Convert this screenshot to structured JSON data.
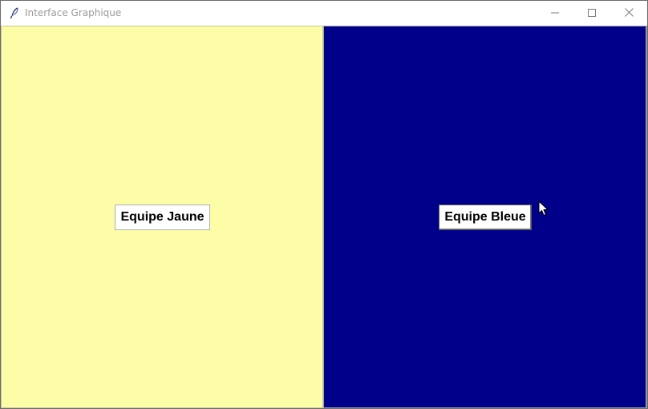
{
  "window": {
    "title": "Interface Graphique",
    "icon": "feather-icon",
    "controls": {
      "minimize": "minimize-icon",
      "maximize": "maximize-icon",
      "close": "close-icon"
    }
  },
  "panels": {
    "yellow": {
      "color": "#fdfca7",
      "button_label": "Equipe Jaune"
    },
    "blue": {
      "color": "#00008b",
      "button_label": "Equipe Bleue"
    }
  }
}
